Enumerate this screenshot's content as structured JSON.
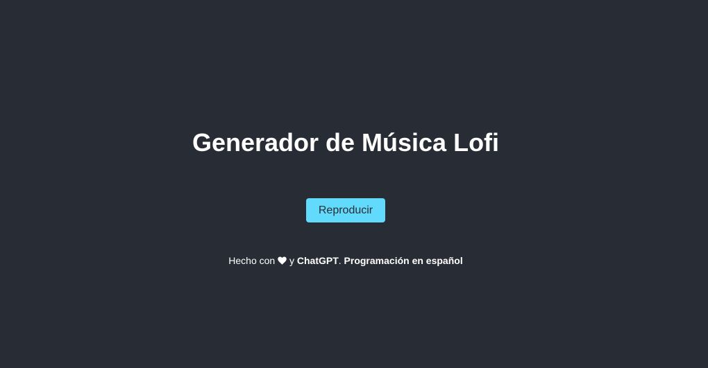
{
  "page": {
    "title": "Generador de Música Lofi"
  },
  "controls": {
    "play_label": "Reproducir"
  },
  "footer": {
    "made_with": "Hecho con",
    "and": "y",
    "chatgpt_link": "ChatGPT",
    "separator": ".",
    "programming_link": "Programación en español"
  },
  "icons": {
    "heart": "heart-icon"
  },
  "colors": {
    "background": "#282c34",
    "accent": "#61dafb",
    "text": "#ffffff"
  }
}
